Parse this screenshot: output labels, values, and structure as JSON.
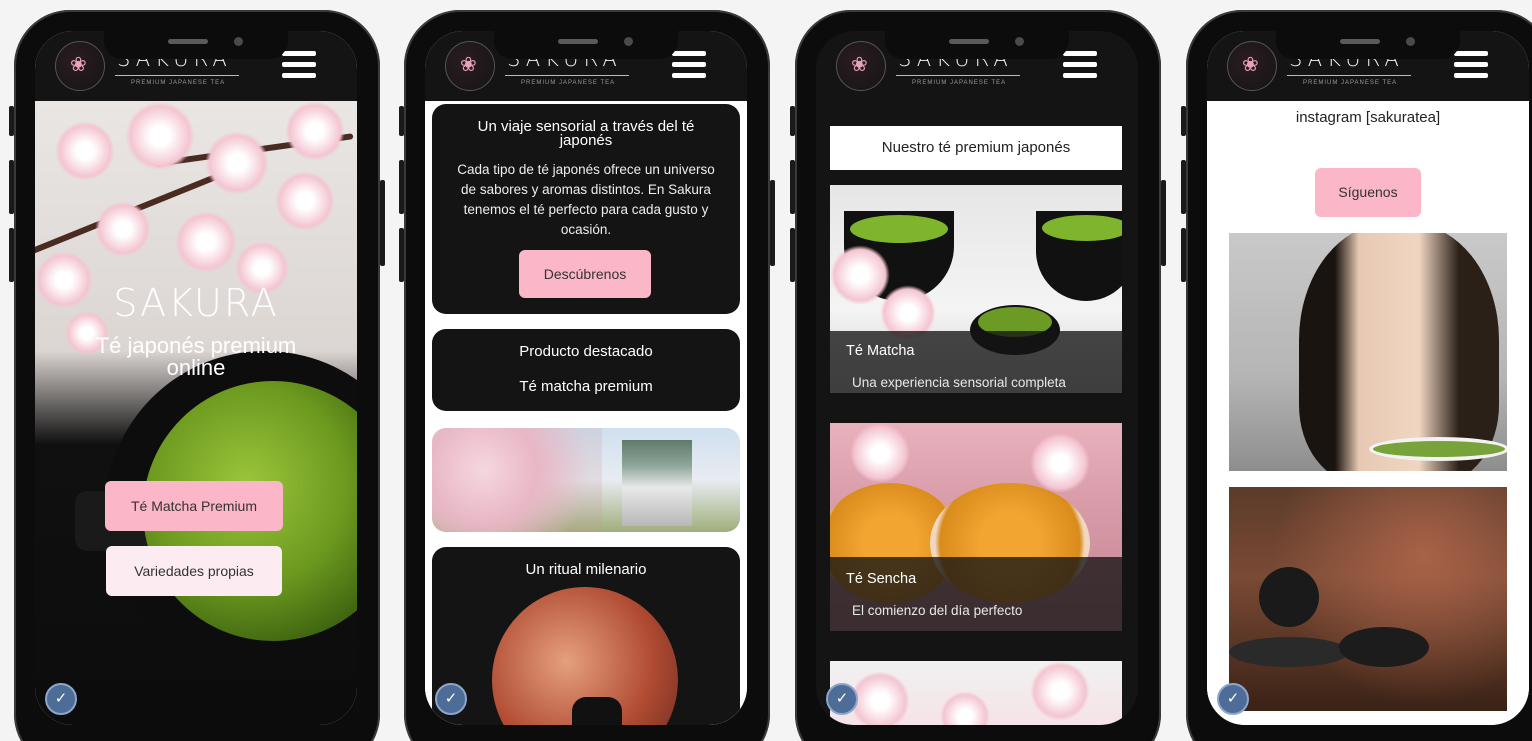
{
  "brand": {
    "name": "SAKURA",
    "tagline": "PREMIUM JAPANESE TEA"
  },
  "phone1": {
    "hero_title": "SAKURA",
    "hero_subtitle": "Té japonés premium online",
    "primary_button": "Té Matcha Premium",
    "secondary_button": "Variedades propias"
  },
  "phone2": {
    "intro_title": "Un viaje sensorial a través del té japonés",
    "intro_text": "Cada tipo de té japonés ofrece un universo de sabores y aromas distintos. En Sakura tenemos el té perfecto para cada gusto y ocasión.",
    "cta_button": "Descúbrenos",
    "featured_title": "Producto destacado",
    "featured_product": "Té matcha premium",
    "ritual_title": "Un ritual milenario"
  },
  "phone3": {
    "section_title": "Nuestro té premium japonés",
    "teas": [
      {
        "name": "Té Matcha",
        "description": "Una experiencia sensorial completa"
      },
      {
        "name": "Té Sencha",
        "description": "El comienzo del día perfecto"
      }
    ]
  },
  "phone4": {
    "instagram_label": "instagram [sakuratea]",
    "follow_button": "Síguenos"
  },
  "colors": {
    "accent_pink": "#fbb6c7",
    "light_pink": "#fcecf1",
    "dark": "#141414",
    "badge_blue": "#4d6c97"
  }
}
